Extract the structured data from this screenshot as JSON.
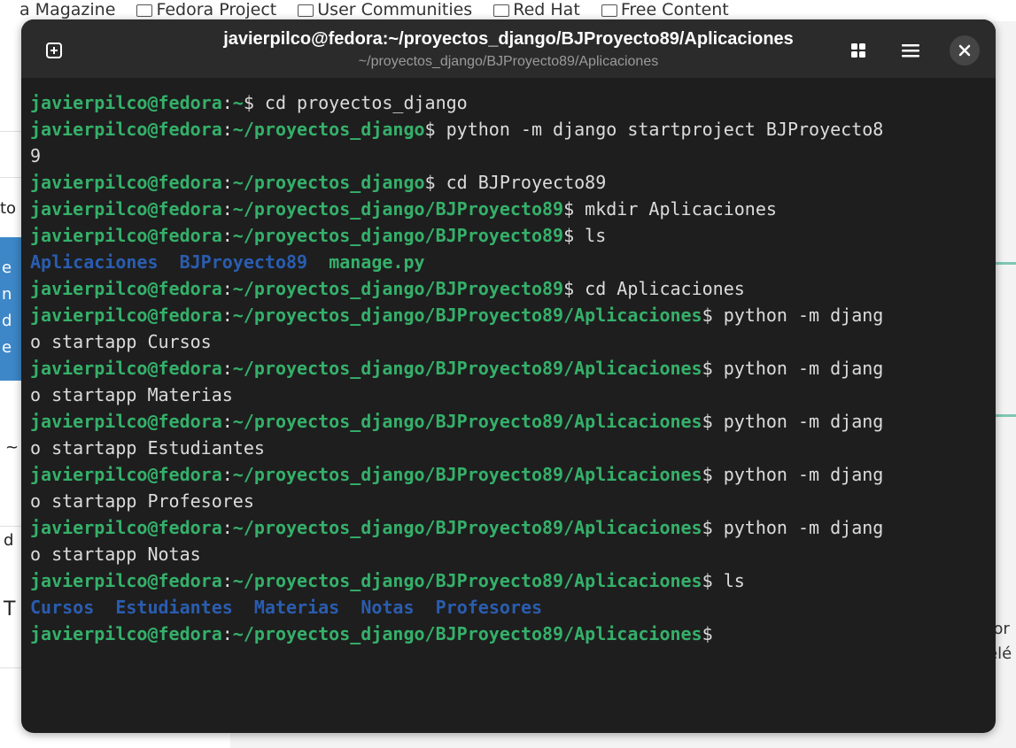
{
  "background": {
    "bookmarks": [
      "a Magazine",
      "Fedora Project",
      "User Communities",
      "Red Hat",
      "Free Content"
    ],
    "fragments": {
      "f1": "to",
      "f2": "e",
      "f3": "n",
      "f4": "d",
      "f5": "e",
      "f6": "~",
      "f7": "d",
      "f8": "T",
      "r1": "for",
      "r2": "elé"
    }
  },
  "window": {
    "title": "javierpilco@fedora:~/proyectos_django/BJProyecto89/Aplicaciones",
    "subtitle": "~/proyectos_django/BJProyecto89/Aplicaciones",
    "buttons": {
      "new_tab_icon": "plus-square-icon",
      "view_icon": "grid-icon",
      "menu_icon": "hamburger-icon",
      "close_icon": "close-icon"
    }
  },
  "terminal": {
    "user": "javierpilco@fedora",
    "lines": [
      {
        "path": "~",
        "cmd": " cd proyectos_django"
      },
      {
        "path": "~/proyectos_django",
        "cmd": " python -m django startproject BJProyecto8"
      },
      {
        "plain": "9"
      },
      {
        "path": "~/proyectos_django",
        "cmd": " cd BJProyecto89"
      },
      {
        "path": "~/proyectos_django/BJProyecto89",
        "cmd": " mkdir Aplicaciones"
      },
      {
        "path": "~/proyectos_django/BJProyecto89",
        "cmd": " ls"
      },
      {
        "ls": [
          {
            "name": "Aplicaciones",
            "kind": "dir"
          },
          {
            "name": "BJProyecto89",
            "kind": "dir"
          },
          {
            "name": "manage.py",
            "kind": "file"
          }
        ]
      },
      {
        "path": "~/proyectos_django/BJProyecto89",
        "cmd": " cd Aplicaciones"
      },
      {
        "path": "~/proyectos_django/BJProyecto89/Aplicaciones",
        "cmd": " python -m djang"
      },
      {
        "plain": "o startapp Cursos"
      },
      {
        "path": "~/proyectos_django/BJProyecto89/Aplicaciones",
        "cmd": " python -m djang"
      },
      {
        "plain": "o startapp Materias"
      },
      {
        "path": "~/proyectos_django/BJProyecto89/Aplicaciones",
        "cmd": " python -m djang"
      },
      {
        "plain": "o startapp Estudiantes"
      },
      {
        "path": "~/proyectos_django/BJProyecto89/Aplicaciones",
        "cmd": " python -m djang"
      },
      {
        "plain": "o startapp Profesores"
      },
      {
        "path": "~/proyectos_django/BJProyecto89/Aplicaciones",
        "cmd": " python -m djang"
      },
      {
        "plain": "o startapp Notas"
      },
      {
        "path": "~/proyectos_django/BJProyecto89/Aplicaciones",
        "cmd": " ls"
      },
      {
        "ls": [
          {
            "name": "Cursos",
            "kind": "dir"
          },
          {
            "name": "Estudiantes",
            "kind": "dir"
          },
          {
            "name": "Materias",
            "kind": "dir"
          },
          {
            "name": "Notas",
            "kind": "dir"
          },
          {
            "name": "Profesores",
            "kind": "dir"
          }
        ]
      },
      {
        "path": "~/proyectos_django/BJProyecto89/Aplicaciones",
        "cmd": ""
      }
    ]
  },
  "colors": {
    "prompt": "#35b06a",
    "directory": "#2a5db0",
    "terminal_bg": "#1e1e1e",
    "titlebar_bg": "#2b2b2b"
  }
}
